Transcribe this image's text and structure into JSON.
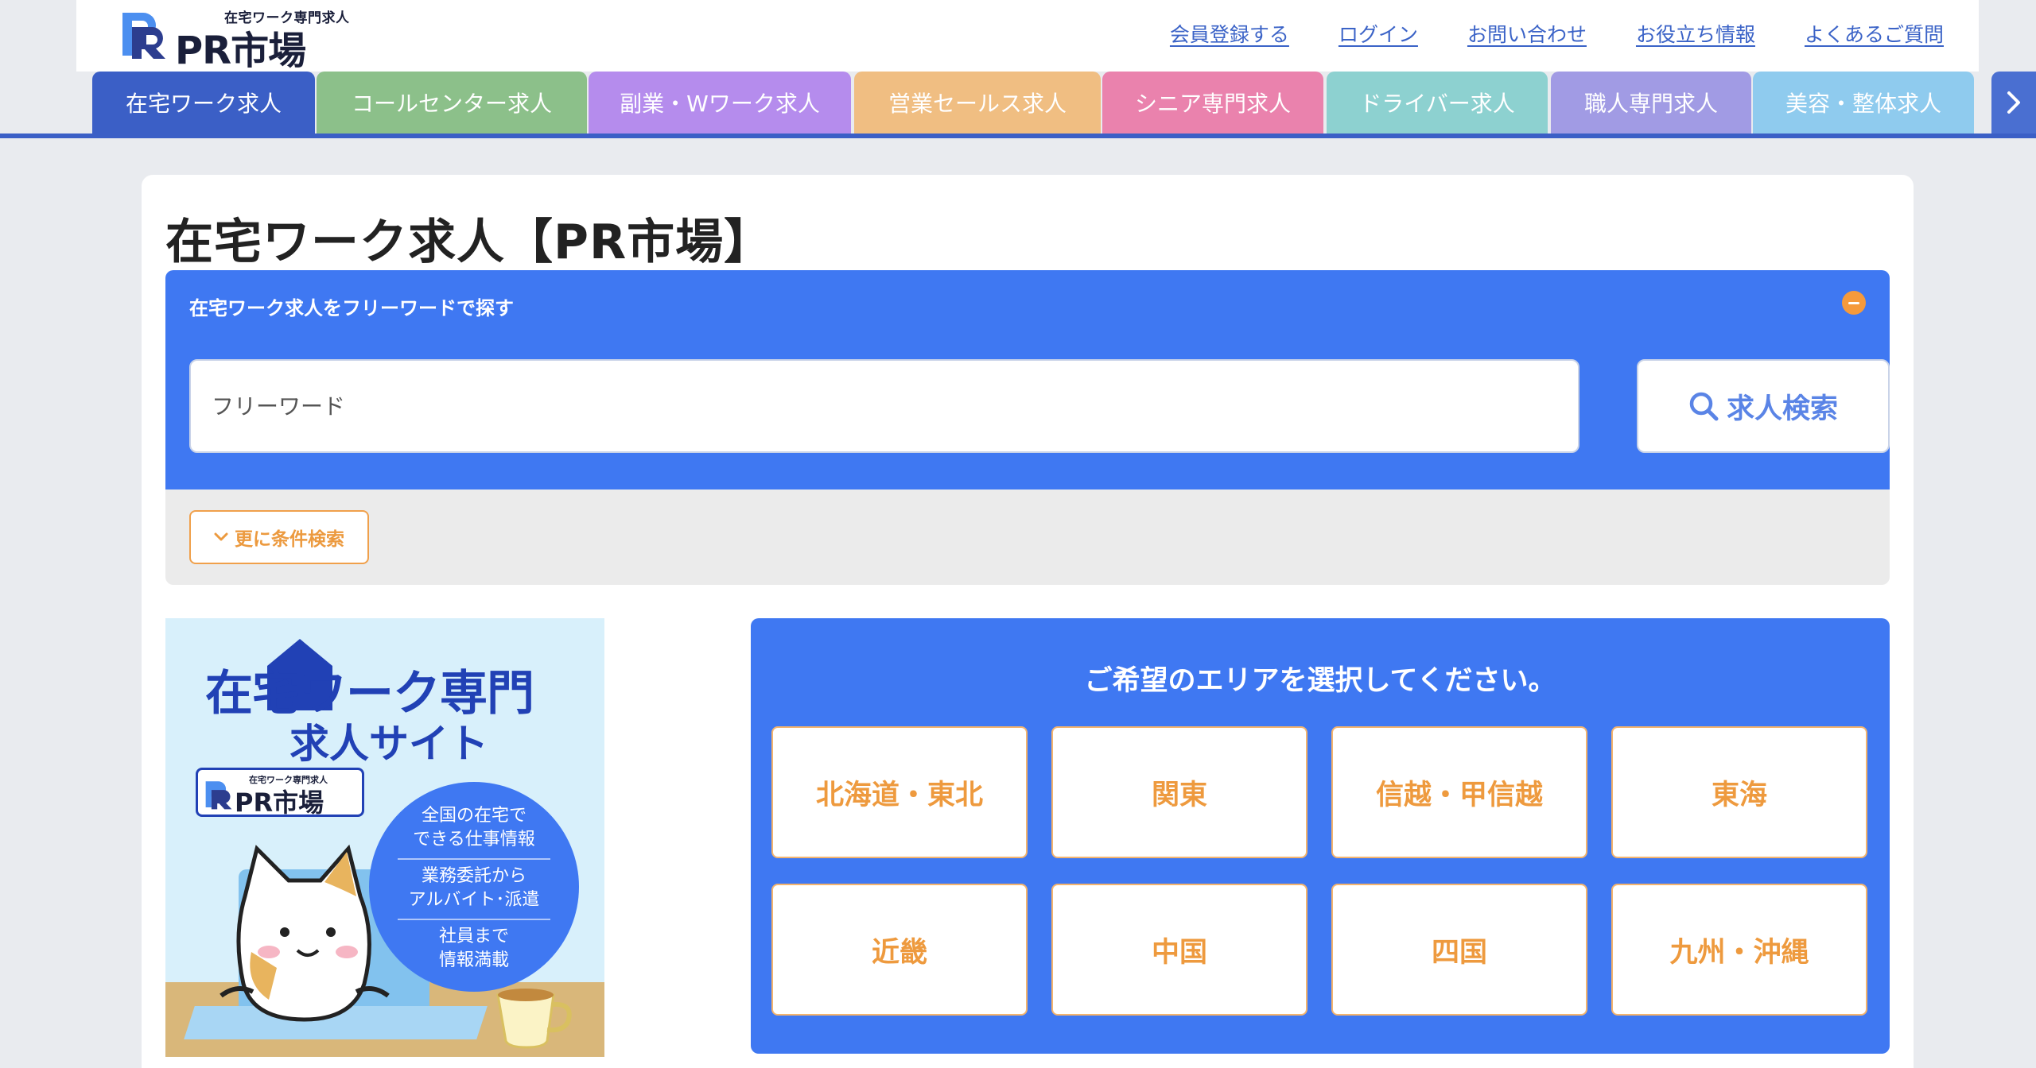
{
  "header": {
    "logo_sub": "在宅ワーク専門求人",
    "logo_name": "PR市場",
    "links": [
      "会員登録する",
      "ログイン",
      "お問い合わせ",
      "お役立ち情報",
      "よくあるご質問"
    ]
  },
  "categories": [
    {
      "label": "在宅ワーク求人",
      "color": "#3b5fc6"
    },
    {
      "label": "コールセンター求人",
      "color": "#8cc08a"
    },
    {
      "label": "副業・Wワーク求人",
      "color": "#b58ced"
    },
    {
      "label": "営業セールス求人",
      "color": "#f0be82"
    },
    {
      "label": "シニア専門求人",
      "color": "#ea82ad"
    },
    {
      "label": "ドライバー求人",
      "color": "#8dd1d0"
    },
    {
      "label": "職人専門求人",
      "color": "#a19be4"
    },
    {
      "label": "美容・整体求人",
      "color": "#8fcbee"
    }
  ],
  "page": {
    "title": "在宅ワーク求人【PR市場】"
  },
  "search": {
    "heading": "在宅ワーク求人をフリーワードで探す",
    "placeholder": "フリーワード",
    "button_label": "求人検索",
    "more_label": "更に条件検索"
  },
  "banner": {
    "title_line1": "在宅ワーク専門",
    "title_line2": "求人サイト",
    "logo_sub": "在宅ワーク専門求人",
    "logo_name": "PR市場",
    "circle_lines": [
      "全国の在宅で",
      "できる仕事情報",
      "業務委託から",
      "アルバイト･派遣",
      "社員まで",
      "情報満載"
    ]
  },
  "area": {
    "heading": "ご希望のエリアを選択してください。",
    "regions": [
      "北海道・東北",
      "関東",
      "信越・甲信越",
      "東海",
      "近畿",
      "中国",
      "四国",
      "九州・沖縄"
    ]
  },
  "colors": {
    "brand_blue": "#3f78f2",
    "accent_orange": "#ee9a3e",
    "link_blue": "#3b63c7"
  }
}
